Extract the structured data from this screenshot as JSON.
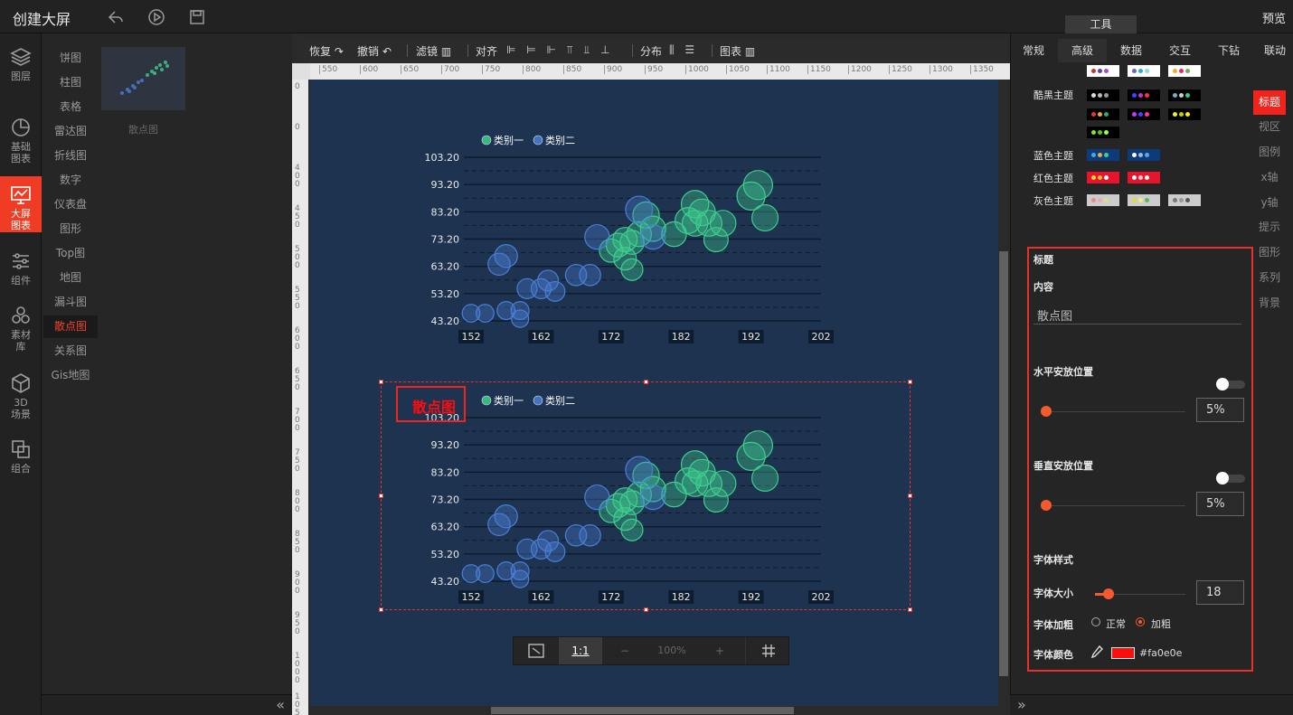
{
  "app": {
    "title": "创建大屏",
    "preview_label": "预览",
    "tools_tab": "工具"
  },
  "leftnav": [
    {
      "label1": "图层",
      "label2": ""
    },
    {
      "label1": "基础",
      "label2": "图表"
    },
    {
      "label1": "大屏",
      "label2": "图表"
    },
    {
      "label1": "组件",
      "label2": ""
    },
    {
      "label1": "素材",
      "label2": "库"
    },
    {
      "label1": "3D",
      "label2": "场景"
    },
    {
      "label1": "组合",
      "label2": ""
    }
  ],
  "categories": [
    "饼图",
    "柱图",
    "表格",
    "雷达图",
    "折线图",
    "数字",
    "仪表盘",
    "图形",
    "Top图",
    "地图",
    "漏斗图",
    "散点图",
    "关系图",
    "Gis地图"
  ],
  "active_category": "散点图",
  "thumbnail_label": "散点图",
  "toolbar": {
    "redo": "恢复",
    "undo": "撤销",
    "filter": "滤镜",
    "align": "对齐",
    "distribute": "分布",
    "chart": "图表"
  },
  "ruler_h": [
    "550",
    "600",
    "650",
    "700",
    "750",
    "800",
    "850",
    "900",
    "950",
    "1000",
    "1050",
    "1100",
    "1150",
    "1200",
    "1250",
    "1300",
    "1350"
  ],
  "ruler_v": [
    "0",
    "0",
    "4 0 0",
    "4 5 0",
    "5 0 0",
    "5 5 0",
    "6 0 0",
    "6 5 0",
    "7 0 0",
    "7 5 0",
    "8 0 0",
    "8 5 0",
    "9 0 0",
    "9 5 0",
    "1 0 0 0",
    "1 0 5 0"
  ],
  "zoom": {
    "ratio": "1:1",
    "minus": "−",
    "plus": "+",
    "level": "100%"
  },
  "chart_title": "散点图",
  "chart_data": [
    {
      "type": "scatter",
      "title": "",
      "legend": [
        "类别一",
        "类别二"
      ],
      "legend_position": "top-left",
      "xlim": [
        152,
        202
      ],
      "ylim": [
        43.2,
        103.2
      ],
      "x_ticks": [
        "152",
        "162",
        "172",
        "182",
        "192",
        "202"
      ],
      "y_ticks": [
        "43.20",
        "53.20",
        "63.20",
        "73.20",
        "83.20",
        "93.20",
        "103.20"
      ],
      "series": [
        {
          "name": "类别一",
          "color": "#3ecf8e",
          "points": [
            [
              178,
              77
            ],
            [
              181,
              75
            ],
            [
              184,
              86
            ],
            [
              183,
              80
            ],
            [
              185,
              83
            ],
            [
              186,
              79
            ],
            [
              187,
              73
            ],
            [
              188,
              79
            ],
            [
              193,
              93
            ],
            [
              192,
              89
            ],
            [
              194,
              81
            ],
            [
              177,
              82
            ],
            [
              176,
              75
            ],
            [
              175,
              72
            ],
            [
              174,
              73
            ],
            [
              173,
              71
            ],
            [
              172,
              69
            ],
            [
              174,
              66
            ],
            [
              175,
              62
            ],
            [
              184,
              79
            ]
          ]
        },
        {
          "name": "类別二",
          "color": "#4a7fd8",
          "points": [
            [
              152,
              46
            ],
            [
              154,
              46
            ],
            [
              157,
              47
            ],
            [
              159,
              47
            ],
            [
              159,
              44
            ],
            [
              160,
              55
            ],
            [
              162,
              55
            ],
            [
              163,
              58
            ],
            [
              164,
              54
            ],
            [
              156,
              64
            ],
            [
              157,
              67
            ],
            [
              167,
              60
            ],
            [
              169,
              60
            ],
            [
              170,
              74
            ],
            [
              176,
              84
            ],
            [
              178,
              74
            ]
          ]
        }
      ]
    },
    {
      "type": "scatter",
      "title": "散点图",
      "legend": [
        "类别一",
        "类别二"
      ],
      "legend_position": "top-left",
      "xlim": [
        152,
        202
      ],
      "ylim": [
        43.2,
        103.2
      ],
      "x_ticks": [
        "152",
        "162",
        "172",
        "182",
        "192",
        "202"
      ],
      "y_ticks": [
        "43.20",
        "53.20",
        "63.20",
        "73.20",
        "83.20",
        "93.20",
        "103.20"
      ],
      "series": [
        {
          "name": "类别一",
          "color": "#3ecf8e",
          "points": [
            [
              178,
              77
            ],
            [
              181,
              75
            ],
            [
              184,
              86
            ],
            [
              183,
              80
            ],
            [
              185,
              83
            ],
            [
              186,
              79
            ],
            [
              187,
              73
            ],
            [
              188,
              79
            ],
            [
              193,
              93
            ],
            [
              192,
              89
            ],
            [
              194,
              81
            ],
            [
              177,
              82
            ],
            [
              176,
              75
            ],
            [
              175,
              72
            ],
            [
              174,
              73
            ],
            [
              173,
              71
            ],
            [
              172,
              69
            ],
            [
              174,
              66
            ],
            [
              175,
              62
            ],
            [
              184,
              79
            ]
          ]
        },
        {
          "name": "类別二",
          "color": "#4a7fd8",
          "points": [
            [
              152,
              46
            ],
            [
              154,
              46
            ],
            [
              157,
              47
            ],
            [
              159,
              47
            ],
            [
              159,
              44
            ],
            [
              160,
              55
            ],
            [
              162,
              55
            ],
            [
              163,
              58
            ],
            [
              164,
              54
            ],
            [
              156,
              64
            ],
            [
              157,
              67
            ],
            [
              167,
              60
            ],
            [
              169,
              60
            ],
            [
              170,
              74
            ],
            [
              176,
              84
            ],
            [
              178,
              74
            ]
          ]
        }
      ]
    }
  ],
  "right_tabs": [
    "常规",
    "高级",
    "数据",
    "交互",
    "下钻",
    "联动"
  ],
  "active_right_tab": "高级",
  "themes": [
    {
      "label": "",
      "swatches": [
        [
          "#fff",
          "#c23531",
          "#6a3d9a",
          "#aa4fcc"
        ],
        [
          "#fff",
          "#66c",
          "#3ac",
          "#8dd"
        ],
        [
          "#fff",
          "#e6b422",
          "#e27",
          "#7a5"
        ]
      ]
    },
    {
      "label": "酷黑主题",
      "swatches": [
        [
          "#000",
          "#ddd",
          "#bbb",
          "#999"
        ],
        [
          "#000",
          "#44f",
          "#c3c",
          "#f33"
        ],
        [
          "#000",
          "#7ac",
          "#ccc",
          "#3c9"
        ],
        [
          "#000",
          "#e33",
          "#ea3",
          "#3a6"
        ],
        [
          "#000",
          "#c3f",
          "#44f",
          "#f3a"
        ],
        [
          "#000",
          "#ee3",
          "#cc0",
          "#fe0"
        ],
        [
          "#000",
          "#7e3",
          "#5c1",
          "#9f4"
        ]
      ]
    },
    {
      "label": "蓝色主题",
      "swatches": [
        [
          "#0d3b7a",
          "#4ad",
          "#ea4",
          "#4c8"
        ],
        [
          "#0d3b7a",
          "#fff",
          "#9bd",
          "#5ad"
        ]
      ]
    },
    {
      "label": "红色主题",
      "swatches": [
        [
          "#e6142d",
          "#fd3",
          "#fb3",
          "#fff"
        ],
        [
          "#e6142d",
          "#fff",
          "#fcc",
          "#fff"
        ]
      ]
    },
    {
      "label": "灰色主题",
      "swatches": [
        [
          "#ccc",
          "#e88",
          "#eaa",
          "#dd8"
        ],
        [
          "#ccc",
          "#dd3",
          "#ee8",
          "#5b5"
        ],
        [
          "#ccc",
          "#777",
          "#999",
          "#555"
        ]
      ]
    }
  ],
  "vnav": [
    "标题",
    "视区",
    "图例",
    "x轴",
    "y轴",
    "提示",
    "图形",
    "系列",
    "背景"
  ],
  "active_vnav": "标题",
  "props": {
    "section_title": "标题",
    "content_label": "内容",
    "content_value": "散点图",
    "h_pos_label": "水平安放位置",
    "h_pos_value": "5%",
    "v_pos_label": "垂直安放位置",
    "v_pos_value": "5%",
    "font_style_label": "字体样式",
    "font_size_label": "字体大小",
    "font_size_value": "18",
    "font_bold_label": "字体加粗",
    "normal_label": "正常",
    "bold_label": "加粗",
    "font_color_label": "字体颜色",
    "font_color_value": "#fa0e0e"
  }
}
